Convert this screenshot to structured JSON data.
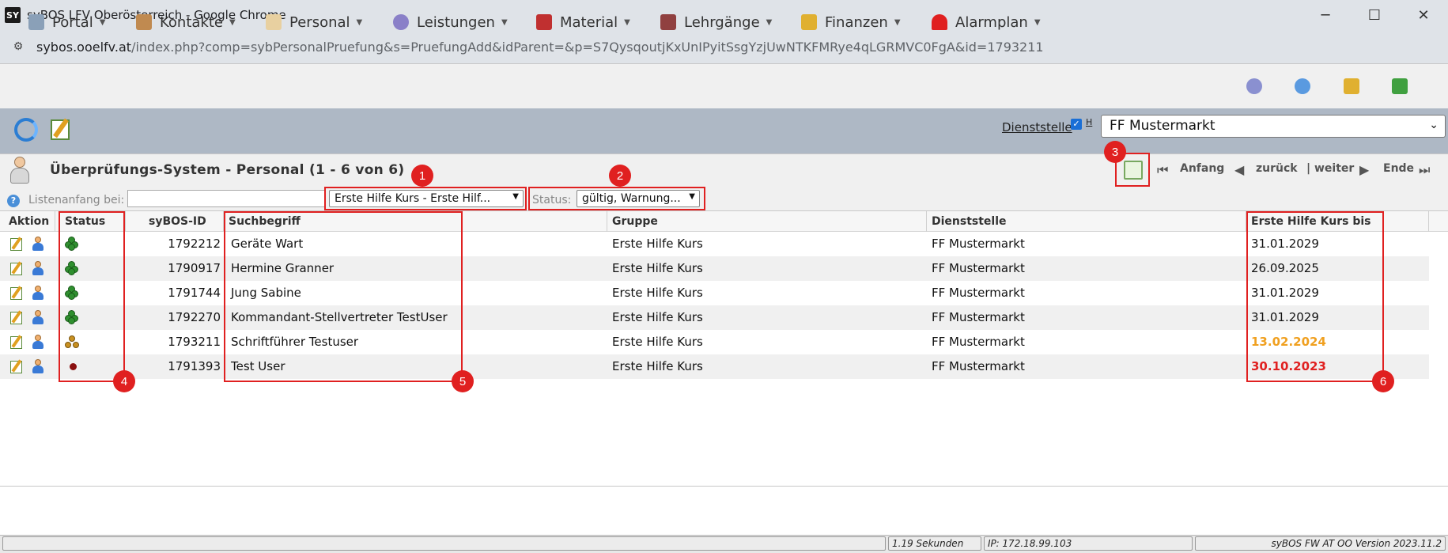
{
  "browser": {
    "favicon": "SY",
    "window_title": "syBOS LFV Oberösterreich - Google Chrome",
    "url_host": "sybos.ooelfv.at",
    "url_rest": "/index.php?comp=sybPersonalPruefung&s=PruefungAdd&idParent=&p=S7QysqoutjKxUnIPyitSsgYzjUwNTKFMRye4qLGRMVC0FgA&id=1793211",
    "minimize": "─",
    "maximize": "☐",
    "close": "✕"
  },
  "menu": {
    "items": [
      {
        "label": "Portal",
        "icon": "portal-icon"
      },
      {
        "label": "Kontakte",
        "icon": "contacts-icon"
      },
      {
        "label": "Personal",
        "icon": "personal-icon"
      },
      {
        "label": "Leistungen",
        "icon": "gear-icon"
      },
      {
        "label": "Material",
        "icon": "truck-icon"
      },
      {
        "label": "Lehrgänge",
        "icon": "course-icon"
      },
      {
        "label": "Finanzen",
        "icon": "money-icon"
      },
      {
        "label": "Alarmplan",
        "icon": "siren-icon"
      }
    ],
    "caret": "▼"
  },
  "toolbar": {
    "dienststelle_label": "Dienststelle",
    "h_label": "H",
    "check": "✓",
    "dienststelle_value": "FF Mustermarkt",
    "select_arrow": "⌄"
  },
  "page": {
    "title": "Überprüfungs-System - Personal (1 - 6 von 6)"
  },
  "pager": {
    "first": "Anfang",
    "back": "zurück",
    "next": "| weiter",
    "end": "Ende",
    "first_icon": "⏮",
    "back_icon": "◀",
    "next_icon": "▶",
    "end_icon": "⏭"
  },
  "filters": {
    "help": "?",
    "listanfang_label": "Listenanfang bei:",
    "listanfang_value": "",
    "kurs_value": "Erste Hilfe Kurs - Erste Hilf...",
    "status_label": "Status:",
    "status_value": "gültig, Warnung...",
    "arrow": "▼"
  },
  "table": {
    "headers": [
      "Aktion",
      "Status",
      "syBOS-ID",
      "Suchbegriff",
      "Gruppe",
      "Dienststelle",
      "Erste Hilfe Kurs bis"
    ],
    "rows": [
      {
        "status": "ok",
        "id": "1792212",
        "suchbegriff": "Geräte Wart",
        "gruppe": "Erste Hilfe Kurs",
        "dienststelle": "FF Mustermarkt",
        "bis": "31.01.2029"
      },
      {
        "status": "ok",
        "id": "1790917",
        "suchbegriff": "Hermine Granner",
        "gruppe": "Erste Hilfe Kurs",
        "dienststelle": "FF Mustermarkt",
        "bis": "26.09.2025"
      },
      {
        "status": "ok",
        "id": "1791744",
        "suchbegriff": "Jung Sabine",
        "gruppe": "Erste Hilfe Kurs",
        "dienststelle": "FF Mustermarkt",
        "bis": "31.01.2029"
      },
      {
        "status": "ok",
        "id": "1792270",
        "suchbegriff": "Kommandant-Stellvertreter TestUser",
        "gruppe": "Erste Hilfe Kurs",
        "dienststelle": "FF Mustermarkt",
        "bis": "31.01.2029"
      },
      {
        "status": "warn",
        "id": "1793211",
        "suchbegriff": "Schriftführer Testuser",
        "gruppe": "Erste Hilfe Kurs",
        "dienststelle": "FF Mustermarkt",
        "bis": "13.02.2024"
      },
      {
        "status": "bad",
        "id": "1791393",
        "suchbegriff": "Test User",
        "gruppe": "Erste Hilfe Kurs",
        "dienststelle": "FF Mustermarkt",
        "bis": "30.10.2023"
      }
    ]
  },
  "annotations": [
    "1",
    "2",
    "3",
    "4",
    "5",
    "6"
  ],
  "statusbar": {
    "time": "1.19 Sekunden",
    "ip": "IP: 172.18.99.103",
    "version": "syBOS FW AT OO Version 2023.11.2"
  },
  "colors": {
    "annotation_red": "#e02020",
    "warn_date": "#f0a020",
    "bad_date": "#e02020",
    "toolbar_bg": "#aeb8c5"
  }
}
